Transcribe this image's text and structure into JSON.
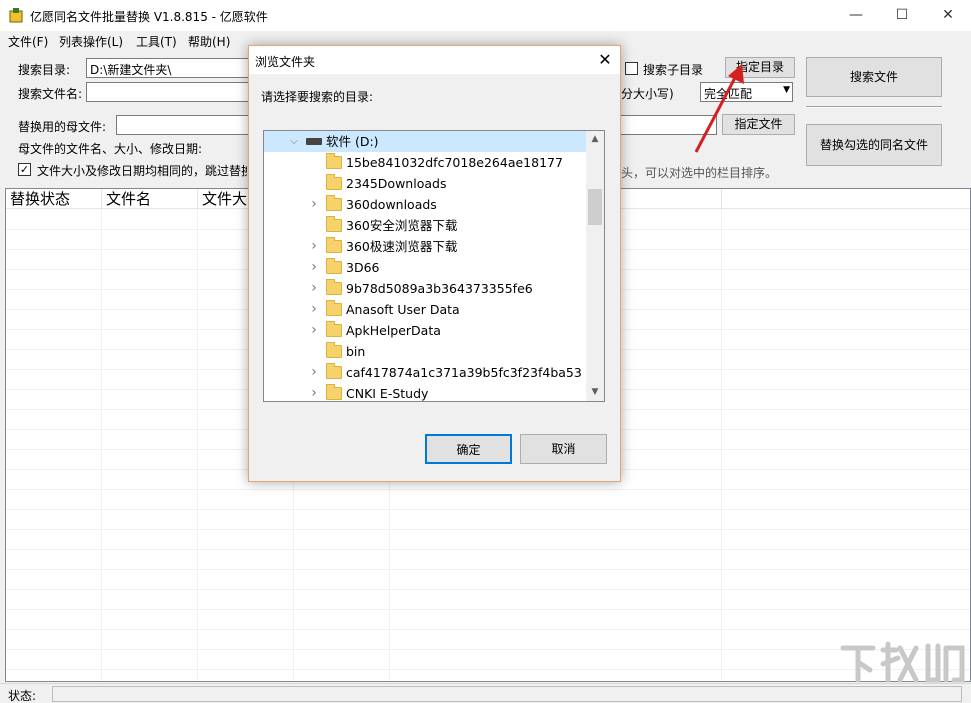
{
  "window": {
    "title": "亿愿同名文件批量替换 V1.8.815 - 亿愿软件",
    "min": "—",
    "max": "☐",
    "close": "✕"
  },
  "menu": [
    {
      "label": "文件(F)"
    },
    {
      "label": "列表操作(L)"
    },
    {
      "label": "工具(T)"
    },
    {
      "label": "帮助(H)"
    }
  ],
  "form": {
    "search_dir_label": "搜索目录:",
    "search_dir_value": "D:\\新建文件夹\\",
    "search_sub_label": "搜索子目录",
    "specify_dir_button": "指定目录",
    "search_files_button": "搜索文件",
    "search_name_label": "搜索文件名:",
    "case_hint": "分大小写)",
    "match_mode_value": "完全匹配",
    "mother_file_label": "替换用的母文件:",
    "specify_file_button": "指定文件",
    "replace_button": "替换勾选的同名文件",
    "mother_info_label": "母文件的文件名、大小、修改日期:",
    "skip_check_label": "文件大小及修改日期均相同的，跳过替换",
    "skip_checked_mark": "✓",
    "sort_hint": "头，可以对选中的栏目排序。"
  },
  "list": {
    "columns": [
      "替换状态",
      "文件名",
      "文件大"
    ]
  },
  "status": {
    "label": "状态:"
  },
  "dialog": {
    "title": "浏览文件夹",
    "close": "✕",
    "prompt": "请选择要搜索的目录:",
    "root": {
      "label": "软件 (D:)",
      "expanded": true
    },
    "folders": [
      {
        "name": "15be841032dfc7018e264ae18177",
        "has_children": false
      },
      {
        "name": "2345Downloads",
        "has_children": false
      },
      {
        "name": "360downloads",
        "has_children": true
      },
      {
        "name": "360安全浏览器下载",
        "has_children": false
      },
      {
        "name": "360极速浏览器下载",
        "has_children": true
      },
      {
        "name": "3D66",
        "has_children": true
      },
      {
        "name": "9b78d5089a3b364373355fe6",
        "has_children": true
      },
      {
        "name": "Anasoft User Data",
        "has_children": true
      },
      {
        "name": "ApkHelperData",
        "has_children": true
      },
      {
        "name": "bin",
        "has_children": false
      },
      {
        "name": "caf417874a1c371a39b5fc3f23f4ba53",
        "has_children": true
      },
      {
        "name": "CNKI E-Study",
        "has_children": true
      }
    ],
    "ok_button": "确定",
    "cancel_button": "取消"
  },
  "colors": {
    "selection": "#cce8ff",
    "accent": "#0078d7",
    "arrow": "#e02020"
  }
}
